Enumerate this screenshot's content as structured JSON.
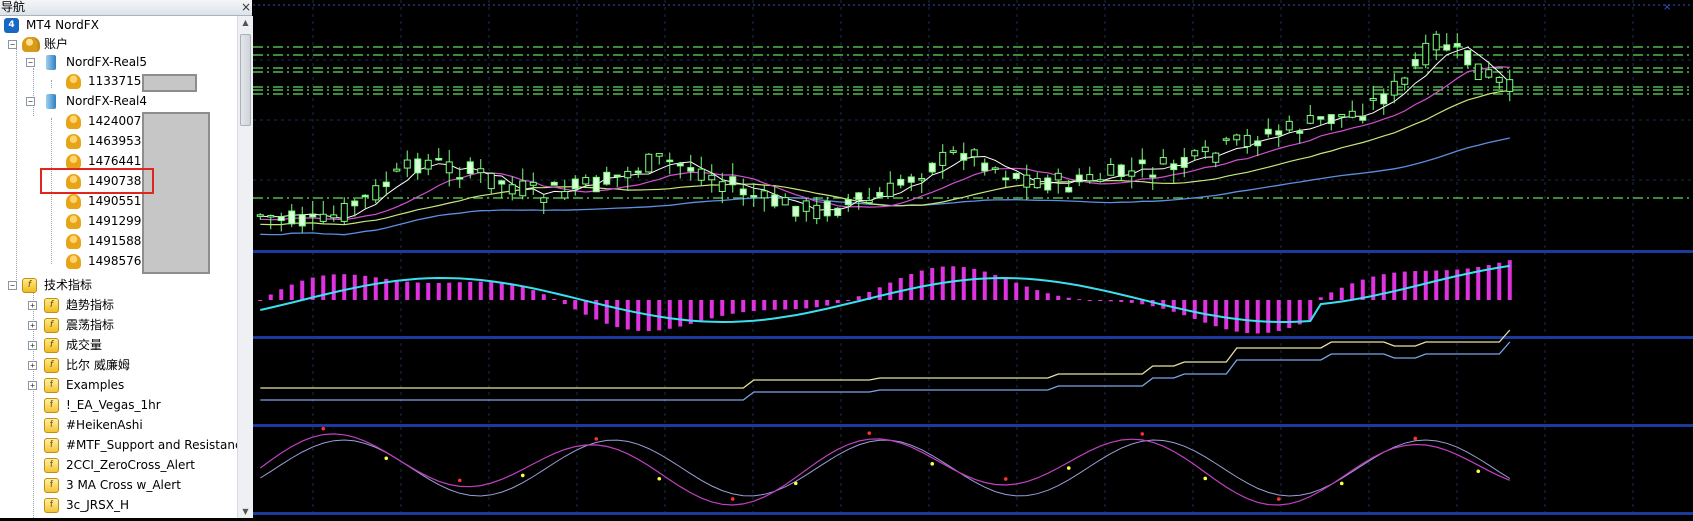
{
  "navigator": {
    "title": "导航",
    "close_glyph": "×",
    "root": "MT4 NordFX",
    "accounts_label": "账户",
    "servers": [
      {
        "name": "NordFX-Real5",
        "accounts": [
          "1133715:"
        ]
      },
      {
        "name": "NordFX-Real4",
        "accounts": [
          "1424007:",
          "1463953:",
          "1476441:",
          "1490738:",
          "1490551:",
          "1491299:",
          "1491588:",
          "1498576:"
        ]
      }
    ],
    "highlighted_account": "1476441:",
    "indicators_label": "技术指标",
    "indicator_groups": [
      "趋势指标",
      "震荡指标",
      "成交量",
      "比尔 威廉姆",
      "Examples"
    ],
    "indicator_items": [
      "!_EA_Vegas_1hr",
      "#HeikenAshi",
      "#MTF_Support and Resistanc",
      "2CCI_ZeroCross_Alert",
      "3 MA Cross w_Alert",
      "3c_JRSX_H"
    ],
    "icons": {
      "root": "mt4-terminal-icon",
      "accounts": "accounts-icon",
      "server": "server-icon",
      "account": "user-account-icon",
      "indicators": "indicators-folder-icon",
      "custom_indicator": "custom-indicator-icon"
    }
  },
  "chart": {
    "colors": {
      "background": "#000000",
      "grid": "#1b2a4d",
      "separator": "#1c3a9c",
      "candle_body": "#d8ffd8",
      "candle_wick": "#7dff7d",
      "level_line": "#5fe05f",
      "macd_hist": "#e033e0",
      "macd_signal": "#3ae0f0",
      "stoch_main": "#e6e3a0",
      "stoch_signal": "#7aa7e6",
      "osc_main": "#c040c0",
      "osc_signal": "#9aa0d8",
      "osc_top_dot": "#ff3030",
      "osc_bottom_dot": "#ffff40",
      "ma_fast": "#ffffff",
      "ma_mid": "#d050d0",
      "ma_slow": "#c8e67a",
      "ma_long": "#5b8fe0"
    },
    "chart_data": {
      "type": "candlestick",
      "panels": [
        "price",
        "macd",
        "stochastic",
        "oscillator"
      ],
      "level_count": 9,
      "candle_count": 120
    }
  }
}
